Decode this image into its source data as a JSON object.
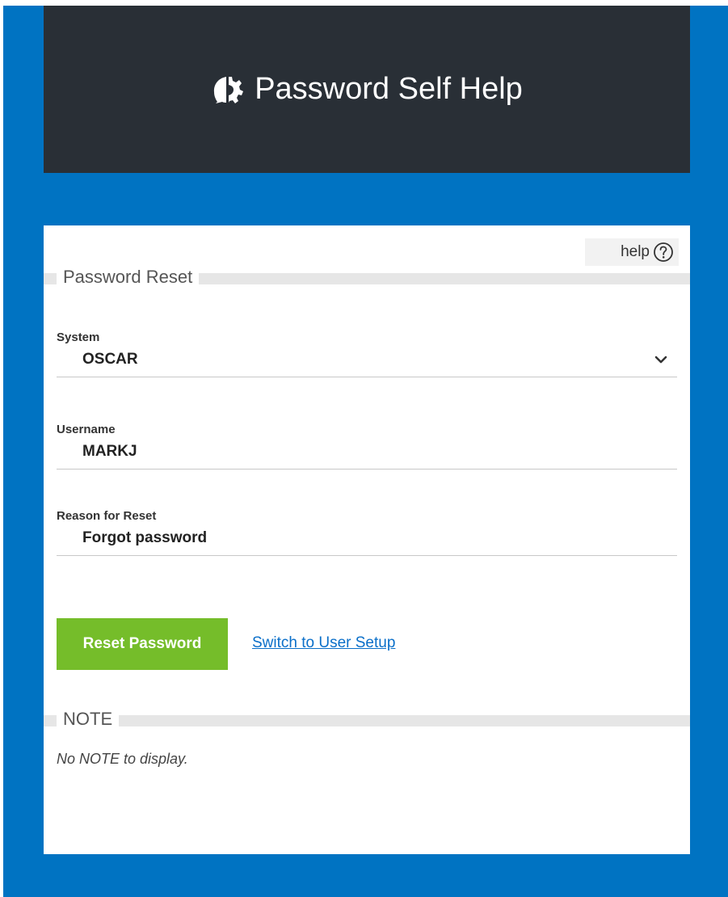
{
  "header": {
    "title": "Password Self Help",
    "logo_icon": "gear-chat-icon"
  },
  "card": {
    "help_label": "help",
    "help_icon": "question-circle-icon",
    "section_title": "Password Reset",
    "fields": {
      "system": {
        "label": "System",
        "value": "OSCAR"
      },
      "username": {
        "label": "Username",
        "value": "MARKJ"
      },
      "reason": {
        "label": "Reason for Reset",
        "value": "Forgot password"
      }
    },
    "reset_button_label": "Reset Password",
    "switch_link_label": "Switch to User Setup",
    "note_section_title": "NOTE",
    "note_text": "No NOTE to display."
  },
  "colors": {
    "frame_blue": "#0073c2",
    "header_dark": "#292f36",
    "button_green": "#75bd2a",
    "link_blue": "#0a6fc9"
  }
}
